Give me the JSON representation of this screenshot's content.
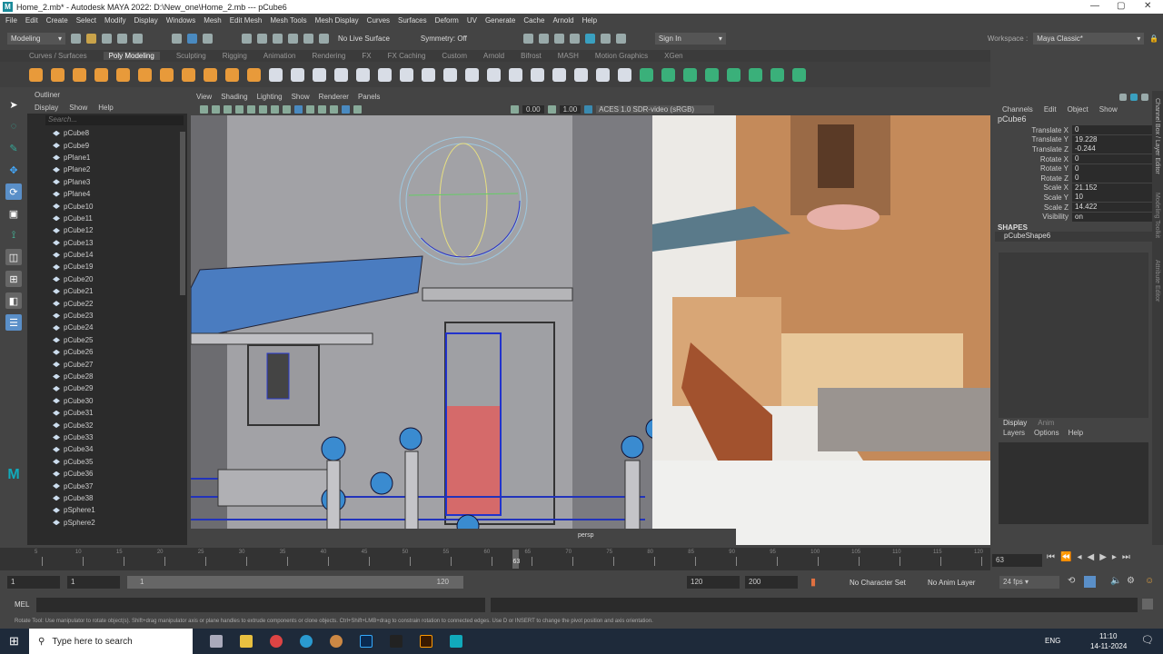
{
  "window": {
    "title": "Home_2.mb* - Autodesk MAYA 2022: D:\\New_one\\Home_2.mb  ---  pCube6"
  },
  "menubar": [
    "File",
    "Edit",
    "Create",
    "Select",
    "Modify",
    "Display",
    "Windows",
    "Mesh",
    "Edit Mesh",
    "Mesh Tools",
    "Mesh Display",
    "Curves",
    "Surfaces",
    "Deform",
    "UV",
    "Generate",
    "Cache",
    "Arnold",
    "Help"
  ],
  "statusline": {
    "mode": "Modeling",
    "live_surface": "No Live Surface",
    "symmetry": "Symmetry: Off",
    "sign_in": "Sign In",
    "workspace_label": "Workspace :",
    "workspace": "Maya Classic*"
  },
  "shelf_tabs": [
    "Curves / Surfaces",
    "Poly Modeling",
    "Sculpting",
    "Rigging",
    "Animation",
    "Rendering",
    "FX",
    "FX Caching",
    "Custom",
    "Arnold",
    "Bifrost",
    "MASH",
    "Motion Graphics",
    "XGen"
  ],
  "shelf_active": "Poly Modeling",
  "outliner": {
    "title": "Outliner",
    "menu": [
      "Display",
      "Show",
      "Help"
    ],
    "search_placeholder": "Search...",
    "items": [
      "pCube8",
      "pCube9",
      "pPlane1",
      "pPlane2",
      "pPlane3",
      "pPlane4",
      "pCube10",
      "pCube11",
      "pCube12",
      "pCube13",
      "pCube14",
      "pCube19",
      "pCube20",
      "pCube21",
      "pCube22",
      "pCube23",
      "pCube24",
      "pCube25",
      "pCube26",
      "pCube27",
      "pCube28",
      "pCube29",
      "pCube30",
      "pCube31",
      "pCube32",
      "pCube33",
      "pCube34",
      "pCube35",
      "pCube36",
      "pCube37",
      "pCube38",
      "pSphere1",
      "pSphere2"
    ]
  },
  "viewport": {
    "menu": [
      "View",
      "Shading",
      "Lighting",
      "Show",
      "Renderer",
      "Panels"
    ],
    "exposure": "0.00",
    "gamma": "1.00",
    "color_space": "ACES 1.0 SDR-video (sRGB)",
    "camera": "persp"
  },
  "channel_box": {
    "menu": [
      "Channels",
      "Edit",
      "Object",
      "Show"
    ],
    "object": "pCube6",
    "channels": [
      {
        "label": "Translate X",
        "value": "0"
      },
      {
        "label": "Translate Y",
        "value": "19.228"
      },
      {
        "label": "Translate Z",
        "value": "-0.244"
      },
      {
        "label": "Rotate X",
        "value": "0"
      },
      {
        "label": "Rotate Y",
        "value": "0"
      },
      {
        "label": "Rotate Z",
        "value": "0"
      },
      {
        "label": "Scale X",
        "value": "21.152"
      },
      {
        "label": "Scale Y",
        "value": "10"
      },
      {
        "label": "Scale Z",
        "value": "14.422"
      },
      {
        "label": "Visibility",
        "value": "on"
      }
    ],
    "shapes_label": "SHAPES",
    "shape": "pCubeShape6",
    "layer_tabs": [
      "Display",
      "Anim"
    ],
    "layer_menu": [
      "Layers",
      "Options",
      "Help"
    ]
  },
  "side_tabs": [
    "Channel Box / Layer Editor",
    "Modeling Toolkit",
    "Attribute Editor"
  ],
  "timeline": {
    "ticks": [
      5,
      10,
      15,
      20,
      25,
      30,
      35,
      40,
      45,
      50,
      55,
      60,
      65,
      70,
      75,
      80,
      85,
      90,
      95,
      100,
      105,
      110,
      115,
      120
    ],
    "current": "63",
    "start": 1,
    "end": 120
  },
  "range": {
    "start": "1",
    "inner_start": "1",
    "slider_start": "1",
    "slider_end": "120",
    "end": "120",
    "max": "200",
    "character_set": "No Character Set",
    "anim_layer": "No Anim Layer",
    "fps": "24 fps"
  },
  "mel": {
    "label": "MEL"
  },
  "helpline": "Rotate Tool: Use manipulator to rotate object(s). Shift+drag manipulator axis or plane handles to extrude components or clone objects. Ctrl+Shift+LMB+drag to constrain rotation to connected edges. Use D or INSERT to change the pivot position and axis orientation.",
  "taskbar": {
    "search_placeholder": "Type here to search",
    "lang": "ENG",
    "time": "11:10",
    "date": "14-11-2024"
  }
}
